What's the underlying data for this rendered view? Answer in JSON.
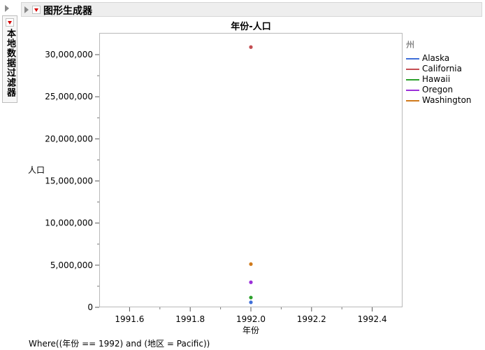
{
  "window": {
    "outline_title": "图形生成器",
    "filter_tab_label": "本地数据过滤器"
  },
  "chart_data": {
    "type": "scatter",
    "title": "年份-人口",
    "xlabel": "年份",
    "ylabel": "人口",
    "xlim": [
      1991.5,
      1992.5
    ],
    "ylim": [
      0,
      32000000
    ],
    "x_ticks": [
      "1991.6",
      "1991.8",
      "1992.0",
      "1992.2",
      "1992.4"
    ],
    "x_tick_values": [
      1991.6,
      1991.8,
      1992.0,
      1992.2,
      1992.4
    ],
    "y_ticks": [
      "0",
      "5,000,000",
      "10,000,000",
      "15,000,000",
      "20,000,000",
      "25,000,000",
      "30,000,000"
    ],
    "y_tick_values": [
      0,
      5000000,
      10000000,
      15000000,
      20000000,
      25000000,
      30000000
    ],
    "legend_title": "州",
    "legend_position": "right",
    "grid": false,
    "series": [
      {
        "name": "Alaska",
        "color": "#3f6fd9",
        "x": [
          1992.0
        ],
        "y": [
          590000
        ]
      },
      {
        "name": "California",
        "color": "#c44e52",
        "x": [
          1992.0
        ],
        "y": [
          30900000
        ]
      },
      {
        "name": "Hawaii",
        "color": "#2ca02c",
        "x": [
          1992.0
        ],
        "y": [
          1160000
        ]
      },
      {
        "name": "Oregon",
        "color": "#9b30d9",
        "x": [
          1992.0
        ],
        "y": [
          2970000
        ]
      },
      {
        "name": "Washington",
        "color": "#d07a1c",
        "x": [
          1992.0
        ],
        "y": [
          5130000
        ]
      }
    ]
  },
  "where_clause": "Where((年份 == 1992) and (地区 = Pacific))"
}
